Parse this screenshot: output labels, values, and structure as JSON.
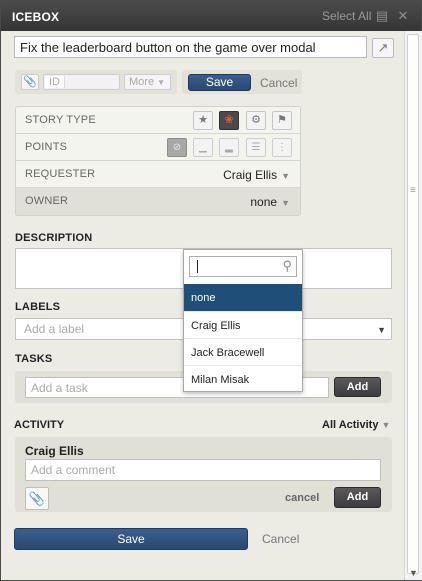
{
  "topbar": {
    "title": "ICEBOX",
    "select_all": "Select All",
    "collapse_icon": "collapse-icon",
    "close_icon": "close-icon"
  },
  "story": {
    "summary": "Fix the leaderboard button on the game over modal",
    "id_label": "ID",
    "more_label": "More",
    "save_label": "Save",
    "cancel_label": "Cancel"
  },
  "properties": {
    "story_type_label": "STORY TYPE",
    "story_types": [
      "feature",
      "bug",
      "chore",
      "release"
    ],
    "selected_story_type": "bug",
    "points_label": "POINTS",
    "points_options": [
      "unestimated",
      "1",
      "2",
      "3",
      "5"
    ],
    "requester_label": "REQUESTER",
    "requester_value": "Craig Ellis",
    "owner_label": "OWNER",
    "owner_value": "none"
  },
  "owner_dropdown": {
    "search_value": "",
    "items": [
      "none",
      "Craig Ellis",
      "Jack Bracewell",
      "Milan Misak"
    ],
    "selected": "none"
  },
  "description": {
    "title": "DESCRIPTION",
    "value": ""
  },
  "labels": {
    "title": "LABELS",
    "placeholder": "Add a label"
  },
  "tasks": {
    "title": "TASKS",
    "placeholder": "Add a task",
    "add_label": "Add"
  },
  "activity": {
    "title": "ACTIVITY",
    "filter_label": "All Activity",
    "comment_author": "Craig Ellis",
    "comment_placeholder": "Add a comment",
    "cancel_label": "cancel",
    "add_label": "Add"
  },
  "footer": {
    "save_label": "Save",
    "cancel_label": "Cancel"
  },
  "colors": {
    "primary_button": "#294872",
    "selected_item": "#1f4e79",
    "dark_button": "#3c3c3c",
    "panel_bg": "#ecebe4",
    "topbar_bg": "#353535"
  }
}
